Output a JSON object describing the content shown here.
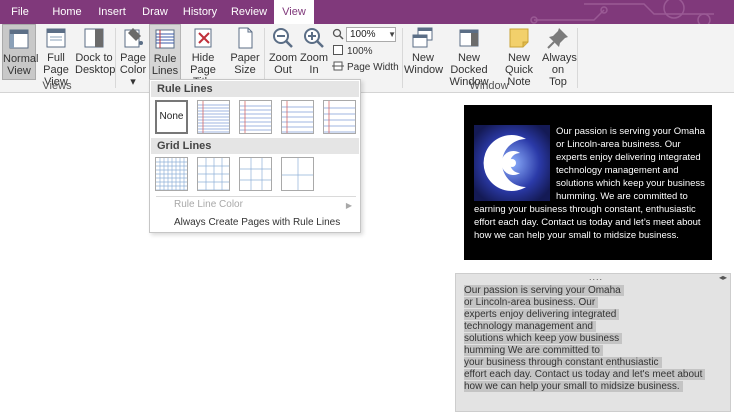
{
  "tabs": [
    "File",
    "Home",
    "Insert",
    "Draw",
    "History",
    "Review",
    "View"
  ],
  "active_tab": "View",
  "colors": {
    "brand": "#80397b",
    "ribbon_bg": "#f3f3f3",
    "selection": "#c4c4c4"
  },
  "ribbon": {
    "views": {
      "normal_view": [
        "Normal",
        "View"
      ],
      "full_page_view": [
        "Full Page",
        "View"
      ],
      "dock_to_desktop": [
        "Dock to",
        "Desktop"
      ],
      "group_label": "Views"
    },
    "page_setup": {
      "page_color": [
        "Page",
        "Color ▾"
      ],
      "rule_lines": [
        "Rule",
        "Lines ▾"
      ],
      "hide_page_title": [
        "Hide",
        "Page Title"
      ],
      "paper_size": [
        "Paper",
        "Size"
      ]
    },
    "zoom": {
      "zoom_out": [
        "Zoom",
        "Out"
      ],
      "zoom_in": [
        "Zoom",
        "In"
      ],
      "zoom_value": "100%",
      "hundred_percent": "100%",
      "page_width": "Page Width"
    },
    "window": {
      "new_window": [
        "New",
        "Window"
      ],
      "new_docked_window": [
        "New Docked",
        "Window"
      ],
      "new_quick_note": [
        "New Quick",
        "Note"
      ],
      "always_on_top": [
        "Always",
        "on Top"
      ],
      "group_label": "Window"
    }
  },
  "rule_lines_menu": {
    "rule_lines_header": "Rule Lines",
    "none_label": "None",
    "grid_lines_header": "Grid Lines",
    "rule_line_color": "Rule Line Color",
    "always_create": "Always Create Pages with Rule Lines"
  },
  "content": {
    "black_box_lines": [
      "Our passion is serving your Omaha",
      "or Lincoln-area business. Our",
      "experts enjoy delivering integrated",
      "technology management and",
      "solutions which keep your business",
      "humming. We are committed to"
    ],
    "black_box_tail": [
      "earning your business through constant, enthusiastic",
      "effort each day. Contact us today and let’s meet about",
      "how we can help your small to midsize business."
    ],
    "container_grip": "....",
    "container_resize": "◂▸",
    "selected_lines": [
      "Our passion is serving your Omaha",
      "or Lincoln-area business. Our",
      "experts enjoy delivering integrated",
      "technology management and",
      "solutions which keep yow business",
      "humming We are committed to",
      "your business through constant enthusiastic",
      "effort each day. Contact us today and let's meet about",
      "how we can help your small to midsize business."
    ]
  }
}
